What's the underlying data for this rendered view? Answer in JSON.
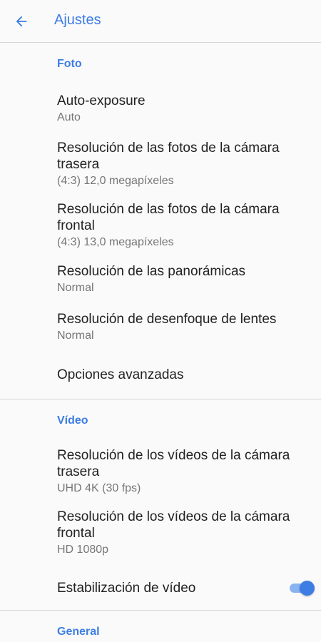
{
  "appbar": {
    "back_icon": "arrow-back-icon",
    "title": "Ajustes"
  },
  "sections": {
    "foto": {
      "header": "Foto",
      "items": [
        {
          "title": "Auto-exposure",
          "summary": "Auto"
        },
        {
          "title": "Resolución de las fotos de la cámara trasera",
          "summary": "(4:3) 12,0 megapíxeles"
        },
        {
          "title": "Resolución de las fotos de la cámara frontal",
          "summary": "(4:3) 13,0 megapíxeles"
        },
        {
          "title": "Resolución de las panorámicas",
          "summary": "Normal"
        },
        {
          "title": "Resolución de desenfoque de lentes",
          "summary": "Normal"
        },
        {
          "title": "Opciones avanzadas"
        }
      ]
    },
    "video": {
      "header": "Vídeo",
      "items": [
        {
          "title": "Resolución de los vídeos de la cámara trasera",
          "summary": "UHD 4K (30 fps)"
        },
        {
          "title": "Resolución de los vídeos de la cámara frontal",
          "summary": "HD 1080p"
        },
        {
          "title": "Estabilización de vídeo",
          "toggle_on": true
        }
      ]
    },
    "general": {
      "header": "General"
    }
  },
  "colors": {
    "accent": "#3d7de4",
    "background": "#fafafa",
    "divider": "#d6d6d6"
  }
}
